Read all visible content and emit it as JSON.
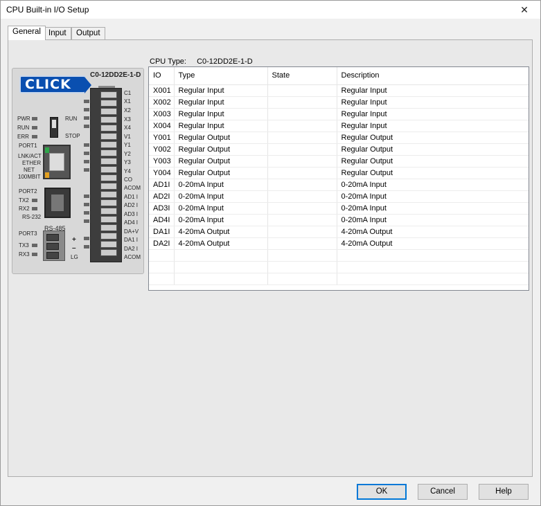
{
  "window": {
    "title": "CPU Built-in I/O Setup",
    "close_glyph": "✕"
  },
  "tabs": [
    {
      "label": "General",
      "active": true
    },
    {
      "label": "Input",
      "active": false
    },
    {
      "label": "Output",
      "active": false
    }
  ],
  "cpu_type": {
    "label": "CPU Type:",
    "value": "C0-12DD2E-1-D"
  },
  "plc": {
    "model": "C0-12DD2E-1-D",
    "logo_text": "CLICK",
    "left_labels": [
      "PWR",
      "RUN",
      "ERR",
      "PORT1",
      "LNK/ACT",
      "ETHER",
      "NET",
      "100MBIT",
      "PORT2",
      "TX2",
      "RX2",
      "RS-232",
      "PORT3",
      "TX3",
      "RX3"
    ],
    "switch_labels": [
      "RUN",
      "STOP"
    ],
    "rs485_labels": [
      "RS-485",
      "+",
      "–",
      "LG"
    ],
    "terminal_labels": [
      "C1",
      "X1",
      "X2",
      "X3",
      "X4",
      "V1",
      "Y1",
      "Y2",
      "Y3",
      "Y4",
      "CO",
      "ACOM",
      "AD1 I",
      "AD2 I",
      "AD3 I",
      "AD4 I",
      "DA+V",
      "DA1 I",
      "DA2 I",
      "ACOM"
    ]
  },
  "table": {
    "columns": [
      "IO",
      "Type",
      "State",
      "Description"
    ],
    "rows": [
      [
        "X001",
        "Regular Input",
        "",
        "Regular Input"
      ],
      [
        "X002",
        "Regular Input",
        "",
        "Regular Input"
      ],
      [
        "X003",
        "Regular Input",
        "",
        "Regular Input"
      ],
      [
        "X004",
        "Regular Input",
        "",
        "Regular Input"
      ],
      [
        "Y001",
        "Regular Output",
        "",
        "Regular Output"
      ],
      [
        "Y002",
        "Regular Output",
        "",
        "Regular Output"
      ],
      [
        "Y003",
        "Regular Output",
        "",
        "Regular Output"
      ],
      [
        "Y004",
        "Regular Output",
        "",
        "Regular Output"
      ],
      [
        "AD1I",
        "0-20mA Input",
        "",
        "0-20mA Input"
      ],
      [
        "AD2I",
        "0-20mA Input",
        "",
        "0-20mA Input"
      ],
      [
        "AD3I",
        "0-20mA Input",
        "",
        "0-20mA Input"
      ],
      [
        "AD4I",
        "0-20mA Input",
        "",
        "0-20mA Input"
      ],
      [
        "DA1I",
        "4-20mA Output",
        "",
        "4-20mA Output"
      ],
      [
        "DA2I",
        "4-20mA Output",
        "",
        "4-20mA Output"
      ],
      [
        "",
        "",
        "",
        ""
      ],
      [
        "",
        "",
        "",
        ""
      ],
      [
        "",
        "",
        "",
        ""
      ]
    ]
  },
  "buttons": {
    "ok": "OK",
    "cancel": "Cancel",
    "help": "Help"
  }
}
